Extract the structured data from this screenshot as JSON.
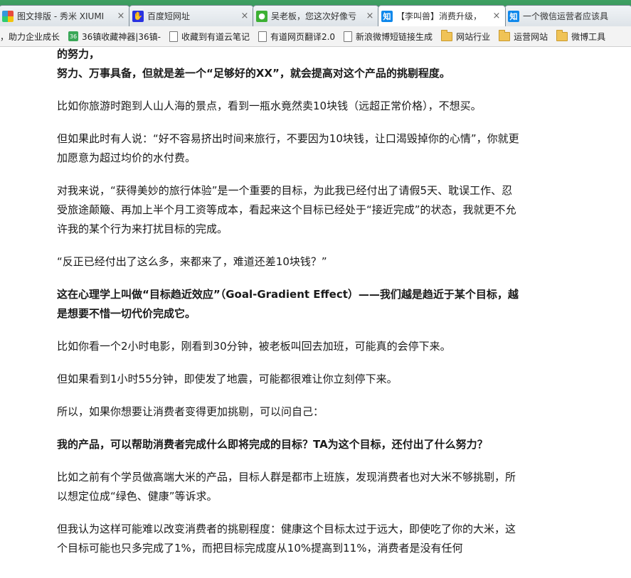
{
  "browser": {
    "tabs": [
      {
        "title": "图文排版 - 秀米 XIUMI",
        "icon": "xiumi-logo-icon",
        "active": false
      },
      {
        "title": "百度短网址",
        "icon": "baidu-paw-icon",
        "active": false
      },
      {
        "title": "吴老板，您这次好像亏",
        "icon": "wechat-icon",
        "active": false
      },
      {
        "title": "【李叫兽】消费升级，",
        "icon": "zhihu-icon",
        "active": true
      },
      {
        "title": "一个微信运营者应该具",
        "icon": "zhihu-icon",
        "active": false
      }
    ],
    "bookmarks": [
      {
        "label": "，助力企业成长",
        "icon": "none"
      },
      {
        "label": "36镇收藏神器|36镇-",
        "icon": "36kr-icon",
        "badge": "36"
      },
      {
        "label": "收藏到有道云笔记",
        "icon": "page-icon"
      },
      {
        "label": "有道网页翻译2.0",
        "icon": "page-icon"
      },
      {
        "label": "新浪微博短链接生成",
        "icon": "page-icon"
      },
      {
        "label": "网站行业",
        "icon": "folder-icon"
      },
      {
        "label": "运营网站",
        "icon": "folder-icon"
      },
      {
        "label": "微博工具",
        "icon": "folder-icon"
      }
    ]
  },
  "article": {
    "paragraphs": [
      {
        "text": "生活的人，我就很难有一个X的理由，因此我就会认为这个目标对我很重要，如果说我付出了很多的努力，",
        "bold": true
      },
      {
        "text": "努力、万事具备，但就是差一个“足够好的XX”，就会提高对这个产品的挑剔程度。",
        "bold": true
      },
      {
        "text": "比如你旅游时跑到人山人海的景点，看到一瓶水竟然卖10块钱（远超正常价格），不想买。",
        "bold": false
      },
      {
        "text": "但如果此时有人说：“好不容易挤出时间来旅行，不要因为10块钱，让口渴毁掉你的心情”，你就更加愿意为超过均价的水付费。",
        "bold": false
      },
      {
        "text": "对我来说，“获得美妙的旅行体验”是一个重要的目标，为此我已经付出了请假5天、耽误工作、忍受旅途颠簸、再加上半个月工资等成本，看起来这个目标已经处于“接近完成”的状态，我就更不允许我的某个行为来打扰目标的完成。",
        "bold": false
      },
      {
        "text": "“反正已经付出了这么多，来都来了，难道还差10块钱？”",
        "bold": false
      },
      {
        "text": "这在心理学上叫做“目标趋近效应”（Goal-Gradient Effect）——我们越是趋近于某个目标，越是想要不惜一切代价完成它。",
        "bold": true
      },
      {
        "text": "比如你看一个2小时电影，刚看到30分钟，被老板叫回去加班，可能真的会停下来。",
        "bold": false
      },
      {
        "text": "但如果看到1小时55分钟，即使发了地震，可能都很难让你立刻停下来。",
        "bold": false
      },
      {
        "text": "所以，如果你想要让消费者变得更加挑剔，可以问自己：",
        "bold": false
      },
      {
        "text": "我的产品，可以帮助消费者完成什么即将完成的目标？TA为这个目标，还付出了什么努力？",
        "bold": true
      },
      {
        "text": "比如之前有个学员做高端大米的产品，目标人群是都市上班族，发现消费者也对大米不够挑剔，所以想定位成“绿色、健康”等诉求。",
        "bold": false
      },
      {
        "text": "但我认为这样可能难以改变消费者的挑剔程度：健康这个目标太过于远大，即使吃了你的大米，这个目标可能也只多完成了1%，而把目标完成度从10%提高到11%，消费者是没有任何",
        "bold": false
      }
    ]
  }
}
